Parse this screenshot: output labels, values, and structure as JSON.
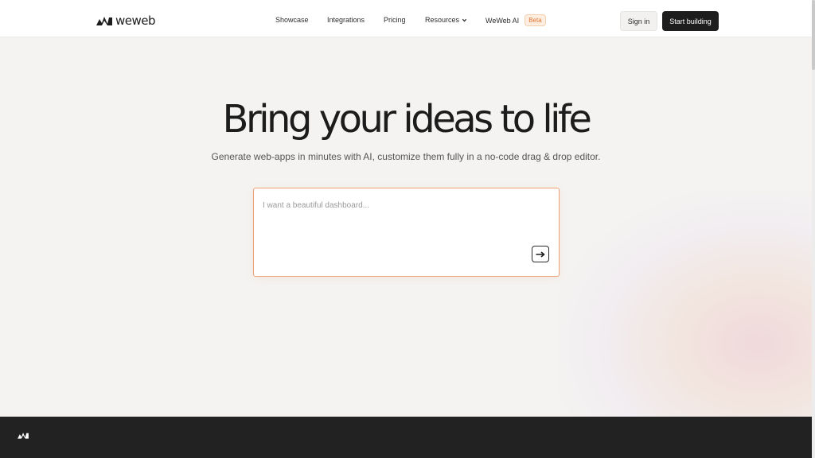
{
  "brand": {
    "name": "weweb"
  },
  "nav": {
    "showcase": "Showcase",
    "integrations": "Integrations",
    "pricing": "Pricing",
    "resources": "Resources",
    "weweb_ai": "WeWeb AI",
    "beta": "Beta"
  },
  "actions": {
    "sign_in": "Sign in",
    "start_building": "Start building"
  },
  "hero": {
    "title": "Bring your ideas to life",
    "subtitle": "Generate web-apps in minutes with AI, customize them fully in a no-code drag & drop editor."
  },
  "prompt": {
    "placeholder": "I want a beautiful dashboard...",
    "value": ""
  },
  "colors": {
    "accent": "#ee9f74",
    "dark": "#1d1d1d",
    "badge": "#e3742f",
    "background": "#f4f3f1"
  },
  "icons": {
    "logo": "weweb-logo-icon",
    "resources_chevron": "chevron-down-icon",
    "submit": "arrow-right-icon",
    "chat": "weweb-logo-icon"
  }
}
